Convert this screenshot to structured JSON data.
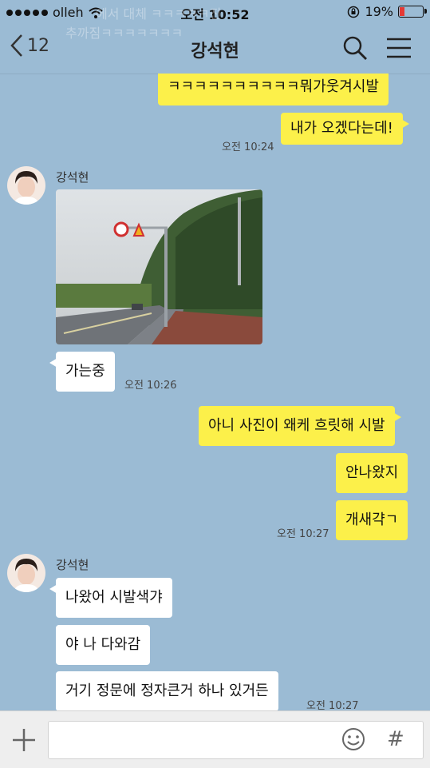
{
  "status_bar": {
    "carrier": "olleh",
    "time": "오전 10:52",
    "battery": "19%",
    "battery_level": 0.19
  },
  "notification_ghost": {
    "line1": "에서 대체 ㅋㅋㅋㅋㅋ진",
    "line2": "추까짐ㅋㅋㅋㅋㅋㅋㅋ"
  },
  "header": {
    "back_count": "12",
    "title": "강석현"
  },
  "messages": [
    {
      "from": "me",
      "text": "ㅋㅋㅋㅋㅋㅋㅋㅋㅋㅋ뭐가웃겨시발"
    },
    {
      "from": "me",
      "text": "내가 오겠다는데!"
    },
    {
      "ts": "오전 10:24"
    },
    {
      "from": "them",
      "sender": "강석현",
      "image": "road-photo"
    },
    {
      "from": "them",
      "text": "가는중"
    },
    {
      "ts": "오전 10:26"
    },
    {
      "from": "me",
      "text": "아니 사진이 왜케 흐릿해 시발"
    },
    {
      "from": "me",
      "text": "안나왔지"
    },
    {
      "from": "me",
      "text": "개새갹ㄱ"
    },
    {
      "ts": "오전 10:27"
    },
    {
      "from": "them",
      "sender": "강석현",
      "text": "나왔어 시발색갸"
    },
    {
      "from": "them",
      "text": "야 나 다와감"
    },
    {
      "from": "them",
      "text": "거기 정문에 정자큰거 하나 있거든"
    },
    {
      "ts": "오전 10:27"
    }
  ],
  "input_bar": {
    "plus_icon": "plus-icon",
    "emoji_icon": "smile-icon",
    "hash_icon": "hash-icon",
    "hash_label": "#"
  },
  "colors": {
    "background": "#9bbbd4",
    "my_bubble": "#fcf04a",
    "their_bubble": "#ffffff",
    "battery_low": "#e53935"
  }
}
